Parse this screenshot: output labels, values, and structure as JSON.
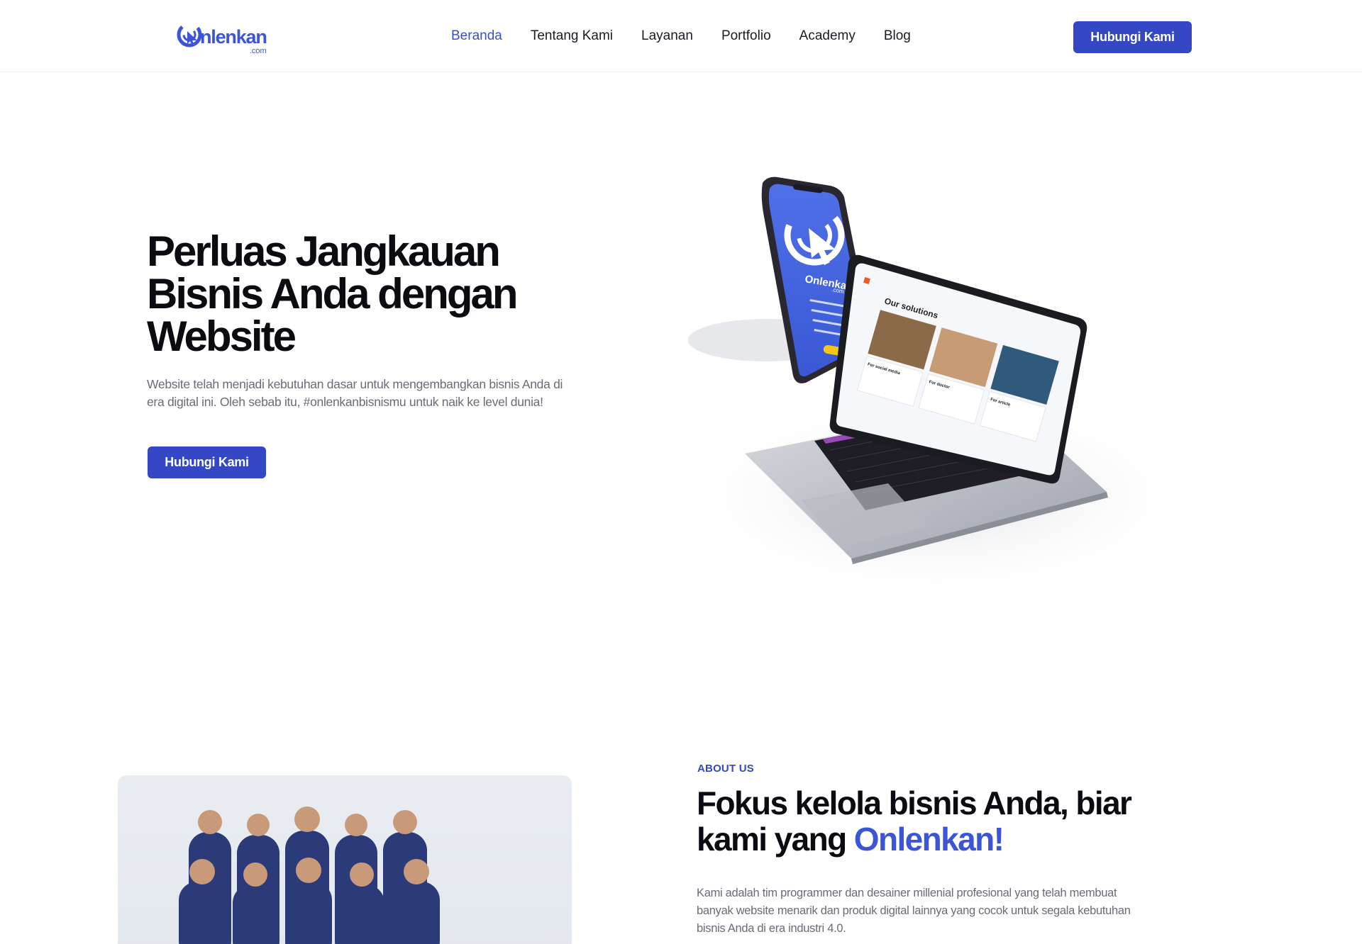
{
  "brand": {
    "name": "nlenkan",
    "suffix": ".com",
    "color": "#3b55d6"
  },
  "nav": {
    "items": [
      {
        "label": "Beranda",
        "active": true
      },
      {
        "label": "Tentang Kami",
        "active": false
      },
      {
        "label": "Layanan",
        "active": false
      },
      {
        "label": "Portfolio",
        "active": false
      },
      {
        "label": "Academy",
        "active": false
      },
      {
        "label": "Blog",
        "active": false
      }
    ],
    "cta_label": "Hubungi Kami"
  },
  "hero": {
    "title": "Perluas Jangkauan Bisnis Anda dengan Website",
    "subtitle": "Website telah menjadi kebutuhan dasar untuk mengembangkan bisnis Anda di era digital ini. Oleh sebab itu, #onlenkanbisnismu untuk naik ke level dunia!",
    "cta_label": "Hubungi Kami",
    "mockup": {
      "phone_brand": "Onlenkan",
      "phone_brand_suffix": ".com",
      "laptop_heading": "Our solutions",
      "laptop_cards": [
        "For social media",
        "For doctor",
        "For article"
      ]
    }
  },
  "about": {
    "eyebrow": "ABOUT US",
    "title_main": "Fokus kelola bisnis Anda, biar kami yang ",
    "title_accent": "Onlenkan!",
    "text": "Kami adalah tim programmer dan desainer millenial profesional yang telah membuat banyak website menarik dan produk digital lainnya yang cocok untuk segala kebutuhan bisnis Anda di era industri 4.0."
  },
  "colors": {
    "primary": "#3448c5",
    "accent": "#3b55d6",
    "heading": "#0b0b12",
    "muted": "#6b6b78"
  }
}
